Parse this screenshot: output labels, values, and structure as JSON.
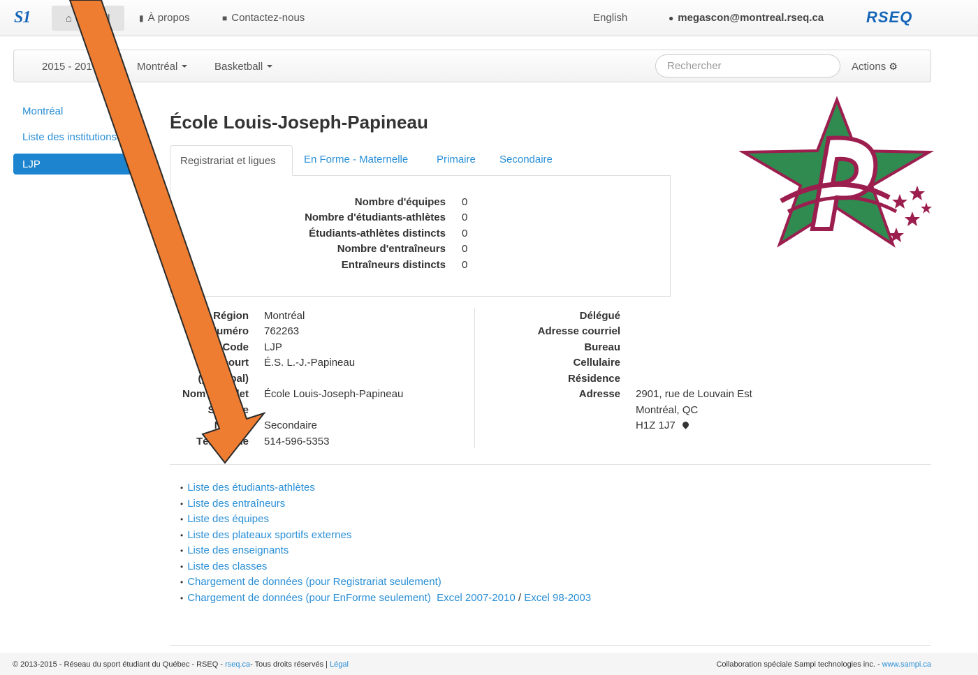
{
  "topbar": {
    "brand": "S1",
    "home_label": "Accueil",
    "about_label": "À propos",
    "contact_label": "Contactez-nous",
    "language_label": "English",
    "user_label": "megascon@montreal.rseq.ca",
    "rseq_brand": "RSEQ"
  },
  "subbar": {
    "season_label": "2015 - 2016",
    "region_label": "Montréal",
    "sport_label": "Basketball",
    "search_placeholder": "Rechercher",
    "actions_label": "Actions"
  },
  "sidebar": {
    "items": [
      {
        "label": "Montréal"
      },
      {
        "label": "Liste des institutions"
      },
      {
        "label": "LJP"
      }
    ]
  },
  "main": {
    "title": "École Louis-Joseph-Papineau",
    "tabs": [
      {
        "label": "Registrariat et ligues"
      },
      {
        "label": "En Forme - Maternelle"
      },
      {
        "label": "Primaire"
      },
      {
        "label": "Secondaire"
      }
    ],
    "stats": [
      {
        "label": "Nombre d'équipes",
        "value": "0"
      },
      {
        "label": "Nombre d'étudiants-athlètes",
        "value": "0"
      },
      {
        "label": "Étudiants-athlètes distincts",
        "value": "0"
      },
      {
        "label": "Nombre d'entraîneurs",
        "value": "0"
      },
      {
        "label": "Entraîneurs distincts",
        "value": "0"
      }
    ],
    "info_left": [
      {
        "label": "Région",
        "value": "Montréal"
      },
      {
        "label": "Numéro",
        "value": "762263"
      },
      {
        "label": "Code",
        "value": "LJP"
      },
      {
        "label": "Nom court",
        "value": "É.S. L.-J.-Papineau"
      },
      {
        "label": "(principal)",
        "value": ""
      },
      {
        "label": "Nom complet",
        "value": "École Louis-Joseph-Papineau"
      },
      {
        "label": "Scolaire",
        "value": ""
      },
      {
        "label": "Niveau",
        "value": "Secondaire"
      },
      {
        "label": "Téléphone",
        "value": "514-596-5353"
      }
    ],
    "info_right": [
      {
        "label": "Délégué",
        "value": ""
      },
      {
        "label": "Adresse courriel",
        "value": ""
      },
      {
        "label": "Bureau",
        "value": ""
      },
      {
        "label": "Cellulaire",
        "value": ""
      },
      {
        "label": "Résidence",
        "value": ""
      },
      {
        "label": "Adresse",
        "value": "2901, rue de Louvain Est"
      }
    ],
    "address_line2": "Montréal, QC",
    "address_line3": "H1Z 1J7",
    "links": [
      "Liste des étudiants-athlètes",
      "Liste des entraîneurs",
      "Liste des équipes",
      "Liste des plateaux sportifs externes",
      "Liste des enseignants",
      "Liste des classes",
      "Chargement de données (pour Registrariat seulement)",
      "Chargement de données (pour EnForme seulement)"
    ],
    "excel_new": "Excel 2007-2010",
    "excel_sep": "/",
    "excel_old": "Excel 98-2003"
  },
  "footer": {
    "left_text": "© 2013-2015 - Réseau du sport étudiant du Québec - RSEQ - ",
    "left_link": "rseq.ca",
    "left_text2": "- Tous droits réservés | ",
    "legal_link": "Légal",
    "right_text": "Collaboration spéciale Sampi technologies inc. - ",
    "right_link": "www.sampi.ca"
  },
  "colors": {
    "link": "#2a8fd6",
    "active_nav": "#1d84cf",
    "arrow": "#ee7d31",
    "logo_green": "#2f8b4f",
    "logo_maroon": "#9c1e4f"
  },
  "icons": [
    "home-icon",
    "file-icon",
    "comment-icon",
    "user-icon",
    "gear-icon",
    "map-marker-icon"
  ]
}
